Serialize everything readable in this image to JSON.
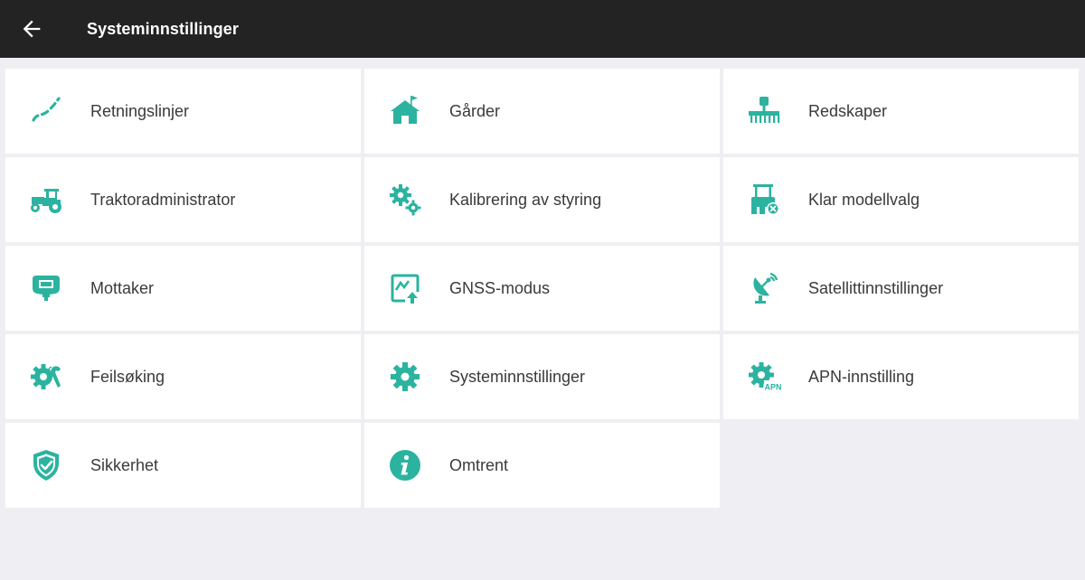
{
  "header": {
    "title": "Systeminnstillinger",
    "back_icon": "arrow-left-icon"
  },
  "accent_color": "#2bb3a0",
  "menu": [
    {
      "label": "Retningslinjer",
      "icon": "guidance-lines-icon"
    },
    {
      "label": "Gårder",
      "icon": "farm-house-icon"
    },
    {
      "label": "Redskaper",
      "icon": "implement-icon"
    },
    {
      "label": "Traktoradministrator",
      "icon": "tractor-icon"
    },
    {
      "label": "Kalibrering av styring",
      "icon": "gears-icon"
    },
    {
      "label": "Klar modellvalg",
      "icon": "tractor-clear-icon"
    },
    {
      "label": "Mottaker",
      "icon": "receiver-icon"
    },
    {
      "label": "GNSS-modus",
      "icon": "gnss-mode-icon"
    },
    {
      "label": "Satellittinnstillinger",
      "icon": "satellite-dish-icon"
    },
    {
      "label": "Feilsøking",
      "icon": "troubleshoot-icon"
    },
    {
      "label": "Systeminnstillinger",
      "icon": "gear-icon"
    },
    {
      "label": "APN-innstilling",
      "icon": "apn-gear-icon"
    },
    {
      "label": "Sikkerhet",
      "icon": "shield-check-icon"
    },
    {
      "label": "Omtrent",
      "icon": "info-icon"
    }
  ]
}
